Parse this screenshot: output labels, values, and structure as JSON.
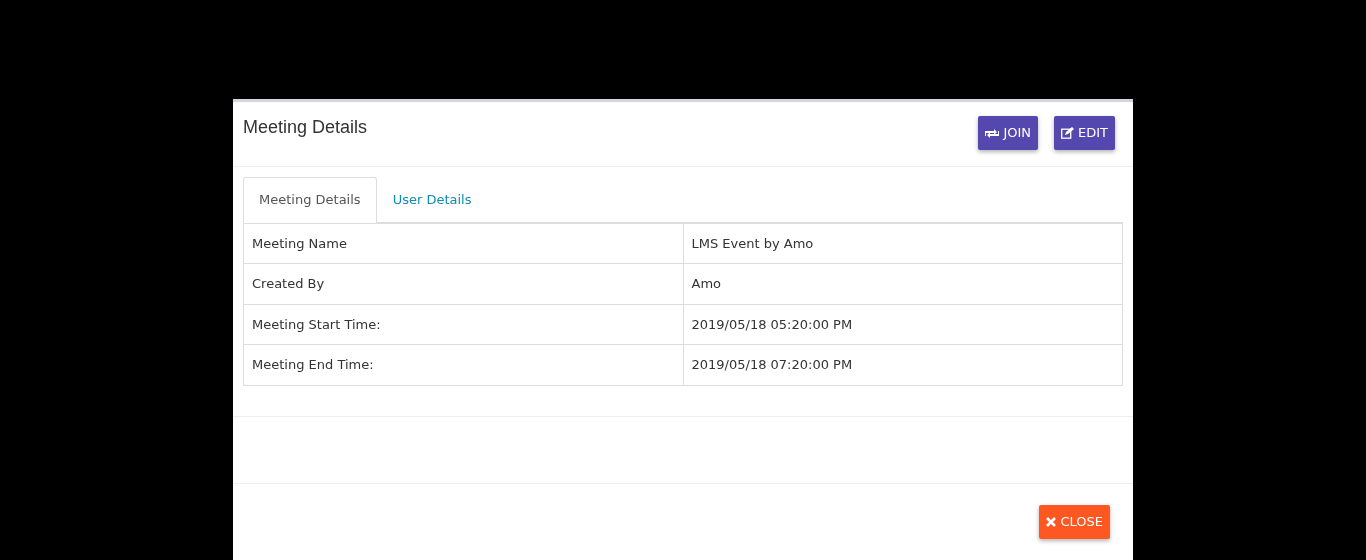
{
  "modal": {
    "title": "Meeting Details",
    "header_buttons": [
      {
        "kind": "join",
        "label": "JOIN"
      },
      {
        "kind": "edit",
        "label": "EDIT"
      }
    ],
    "tabs": [
      {
        "label": "Meeting Details",
        "selected": true
      },
      {
        "label": "User Details",
        "selected": false
      }
    ],
    "table": {
      "rows": [
        {
          "label": "Meeting Name",
          "value": "LMS Event by Amo"
        },
        {
          "label": "Created By",
          "value": "Amo"
        },
        {
          "label": "Meeting Start Time:",
          "value": "2019/05/18 05:20:00 PM"
        },
        {
          "label": "Meeting End Time:",
          "value": "2019/05/18 07:20:00 PM"
        }
      ]
    },
    "footer_buttons": [
      {
        "kind": "close",
        "label": "CLOSE"
      }
    ]
  }
}
